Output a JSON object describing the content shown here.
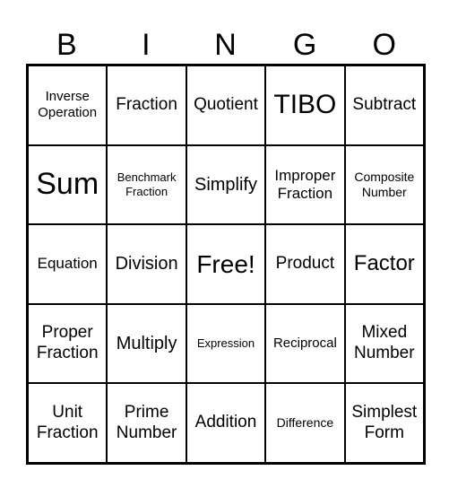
{
  "header": [
    "B",
    "I",
    "N",
    "G",
    "O"
  ],
  "cells": [
    "Inverse Operation",
    "Fraction",
    "Quotient",
    "TIBO",
    "Subtract",
    "Sum",
    "Benchmark Fraction",
    "Simplify",
    "Improper Fraction",
    "Composite Number",
    "Equation",
    "Division",
    "Free!",
    "Product",
    "Factor",
    "Proper Fraction",
    "Multiply",
    "Expression",
    "Reciprocal",
    "Mixed Number",
    "Unit Fraction",
    "Prime Number",
    "Addition",
    "Difference",
    "Simplest Form"
  ]
}
